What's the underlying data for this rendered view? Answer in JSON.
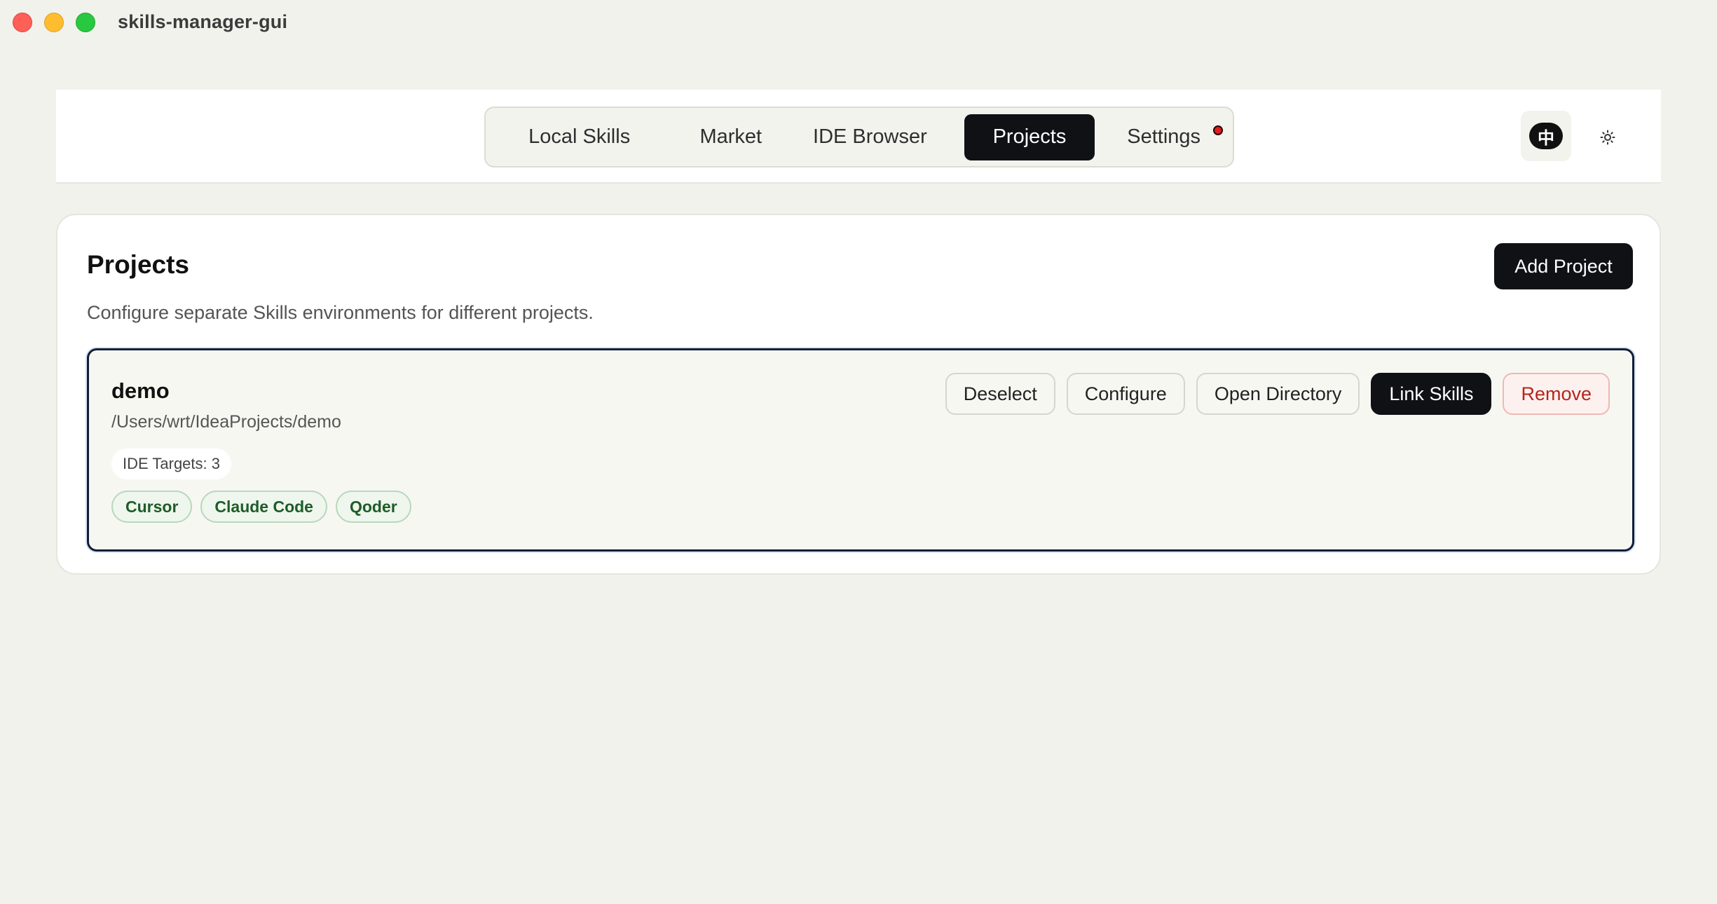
{
  "window": {
    "title": "skills-manager-gui"
  },
  "nav": {
    "tabs": [
      {
        "label": "Local Skills"
      },
      {
        "label": "Market"
      },
      {
        "label": "IDE Browser"
      },
      {
        "label": "Projects",
        "active": true
      },
      {
        "label": "Settings",
        "has_notification": true
      }
    ],
    "language_label": "中",
    "theme_icon": "sun-icon"
  },
  "page": {
    "title": "Projects",
    "subtitle": "Configure separate Skills environments for different projects.",
    "add_button": "Add Project"
  },
  "projects": [
    {
      "name": "demo",
      "path": "/Users/wrt/IdeaProjects/demo",
      "targets_label": "IDE Targets: 3",
      "ides": [
        "Cursor",
        "Claude Code",
        "Qoder"
      ],
      "actions": {
        "deselect": "Deselect",
        "configure": "Configure",
        "open_directory": "Open Directory",
        "link_skills": "Link Skills",
        "remove": "Remove"
      }
    }
  ],
  "colors": {
    "background": "#f2f2ec",
    "primary": "#0f1115",
    "tag_text": "#1f5c27",
    "danger": "#b3261e",
    "notification": "#e11d1d"
  }
}
